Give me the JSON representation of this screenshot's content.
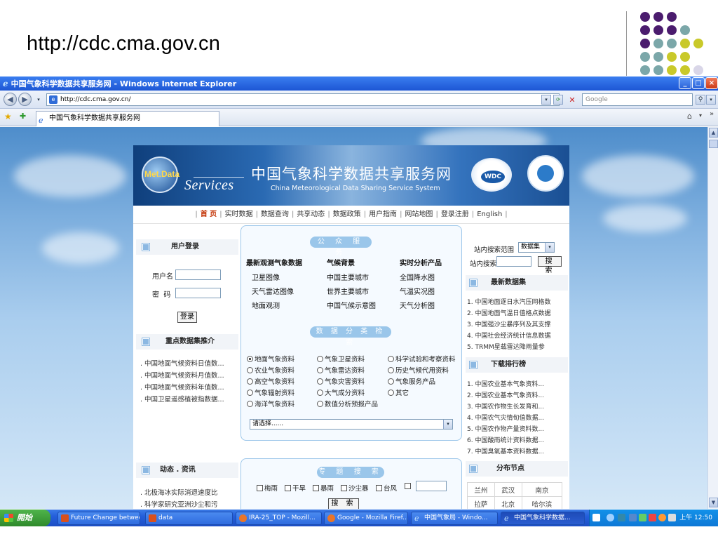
{
  "slide": {
    "title": "http://cdc.cma.gov.cn"
  },
  "browser": {
    "window_title": "中国气象科学数据共享服务网 - Windows Internet Explorer",
    "address": "http://cdc.cma.gov.cn/",
    "search_placeholder": "Google",
    "tab_title": "中国气象科学数据共享服务网",
    "min_label": "_",
    "max_label": "□",
    "close_label": "×"
  },
  "site": {
    "logo_text": "Met.Data",
    "services_text": "Services",
    "title_cn": "中国气象科学数据共享服务网",
    "title_en": "China Meteorological Data Sharing Service System",
    "wdc_text": "WDC",
    "nav": [
      "首 页",
      "实时数据",
      "数据查询",
      "共享动态",
      "数据政策",
      "用户指南",
      "网站地图",
      "登录注册",
      "English"
    ]
  },
  "left": {
    "login_title": "用户登录",
    "username_label": "用户名",
    "password_label": "密  码",
    "login_button": "登录",
    "featured_title": "重点数据集推介",
    "featured_items": [
      ". 中国地面气候资料日值数...",
      ". 中国地面气候资料月值数...",
      ". 中国地面气候资料年值数...",
      ". 中国卫星遥感植被指数据..."
    ],
    "news_title": "动态 . 资讯",
    "news_items": [
      ". 北极海冰实际消退速度比",
      ". 科学家研究亚洲沙尘和污"
    ]
  },
  "center": {
    "public_service_title": "公 众 服 务",
    "col_headers": [
      "最新观测气象数据",
      "气候背景",
      "实时分析产品"
    ],
    "col1": [
      "卫星图像",
      "天气雷达图像",
      "地面观测"
    ],
    "col2": [
      "中国主要城市",
      "世界主要城市",
      "中国气候示意图"
    ],
    "col3": [
      "全国降水图",
      "气温实况图",
      "天气分析图"
    ],
    "classify_title": "数 据 分 类 检 索",
    "radios": [
      [
        "地面气象资料",
        "气象卫星资料",
        "科学试验和考察资料"
      ],
      [
        "农业气象资料",
        "气象雷达资料",
        "历史气候代用资料"
      ],
      [
        "高空气象资料",
        "气象灾害资料",
        "气象服务产品"
      ],
      [
        "气象辐射资料",
        "大气成分资料",
        "其它"
      ],
      [
        "海洋气象资料",
        "数值分析预报产品",
        ""
      ]
    ],
    "select_value": "请选择......",
    "topic_title": "专 题 搜 索",
    "topic_checks": [
      "梅雨",
      "干旱",
      "暴雨",
      "沙尘暴",
      "台风",
      ""
    ],
    "topic_search_button": "搜 索"
  },
  "right": {
    "scope_label": "站内搜索范围",
    "scope_value": "数据集",
    "search_label": "站内搜索",
    "search_button": "搜 索",
    "latest_title": "最新数据集",
    "latest_items": [
      "1. 中国地面逐日水汽压网格数",
      "2. 中国地面气温日值格点数据",
      "3. 中国强沙尘暴序列及其支撑",
      "4. 中国社会经济统计信息数据",
      "5. TRMM星载雷达降雨量参"
    ],
    "download_title": "下载排行榜",
    "download_items": [
      "1.  中国农业基本气象资料...",
      "2.  中国农业基本气象资料...",
      "3.  中国农作物生长发育和...",
      "4.  中国农气灾情旬值数据...",
      "5.  中国农作物产量资料数...",
      "6.  中国酸雨统计资料数据...",
      "7.  中国臭氧基本资料数据..."
    ],
    "nodes_title": "分布节点",
    "nodes": [
      [
        "兰州",
        "武汉",
        "南京"
      ],
      [
        "拉萨",
        "北京",
        "哈尔滨"
      ]
    ]
  },
  "taskbar": {
    "start_label": "開始",
    "tasks": [
      "Future Change betwee...",
      "data",
      "IRA-25_TOP - Mozill...",
      "Google - Mozilla Firef...",
      "中国气象局 - Windo...",
      "中国气象科学数据..."
    ],
    "clock": "上午 12:50"
  },
  "colors": {
    "dots_purple": "#4b1c6e",
    "dots_teal": "#7ba7a9",
    "dots_yellow": "#c9c92a",
    "dots_lilac": "#d9d6e8"
  }
}
